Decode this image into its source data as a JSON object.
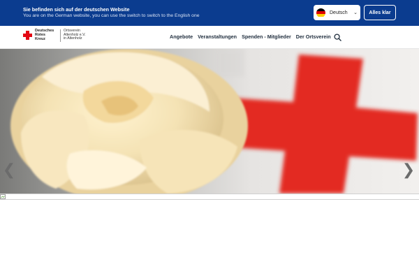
{
  "language_banner": {
    "title": "Sie befinden sich auf der deutschen Website",
    "subtitle": "You are on the German website, you can use the switch to switch to the English one",
    "language_select": {
      "value": "Deutsch",
      "flag_icon": "germany-flag-icon"
    },
    "accept_label": "Alles klar"
  },
  "header": {
    "logo": {
      "name_lines": [
        "Deutsches",
        "Rotes",
        "Kreuz"
      ],
      "org_lines": [
        "Ortsverein",
        "Altenholz e.V.",
        "in Altenholz"
      ]
    },
    "nav": [
      "Angebote",
      "Veranstaltungen",
      "Spenden - Mitglieder",
      "Der Ortsverein"
    ],
    "search_icon": "search-icon"
  },
  "hero": {
    "image": "white-rose-red-cross-photo",
    "prev_icon": "chevron-left-icon",
    "next_icon": "chevron-right-icon"
  },
  "colors": {
    "banner": "#0b3c8f",
    "red_cross": "#e30613",
    "nav_text": "#1f2d3d"
  }
}
